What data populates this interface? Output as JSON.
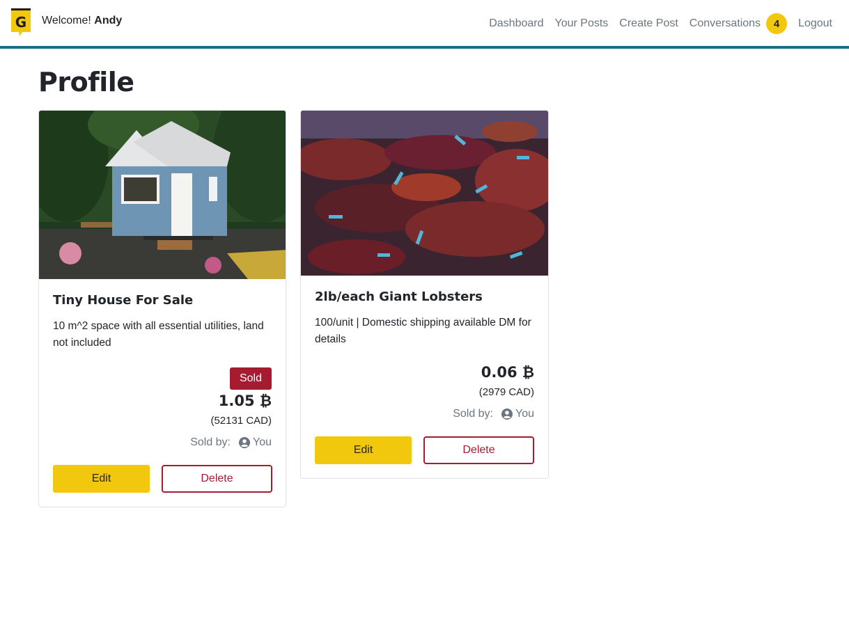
{
  "header": {
    "logo_letter": "G",
    "welcome_prefix": "Welcome!",
    "username": "Andy",
    "nav": {
      "dashboard": "Dashboard",
      "your_posts": "Your Posts",
      "create_post": "Create Post",
      "conversations": "Conversations",
      "conversations_count": "4",
      "logout": "Logout"
    }
  },
  "page": {
    "title": "Profile"
  },
  "posts": [
    {
      "title": "Tiny House For Sale",
      "description": "10 m^2 space with all essential utilities, land not included",
      "status_badge": "Sold",
      "price": "1.05 ₿",
      "price_cad": "(52131 CAD)",
      "sold_by_label": "Sold by:",
      "seller": "You",
      "edit_label": "Edit",
      "delete_label": "Delete",
      "image": "tiny-house-photo"
    },
    {
      "title": "2lb/each Giant Lobsters",
      "description": "100/unit | Domestic shipping available DM for details",
      "price": "0.06 ₿",
      "price_cad": "(2979 CAD)",
      "sold_by_label": "Sold by:",
      "seller": "You",
      "edit_label": "Edit",
      "delete_label": "Delete",
      "image": "lobsters-photo"
    }
  ],
  "colors": {
    "accent_yellow": "#f2c80f",
    "header_border": "#1c6e85",
    "danger_red": "#a51c30"
  }
}
